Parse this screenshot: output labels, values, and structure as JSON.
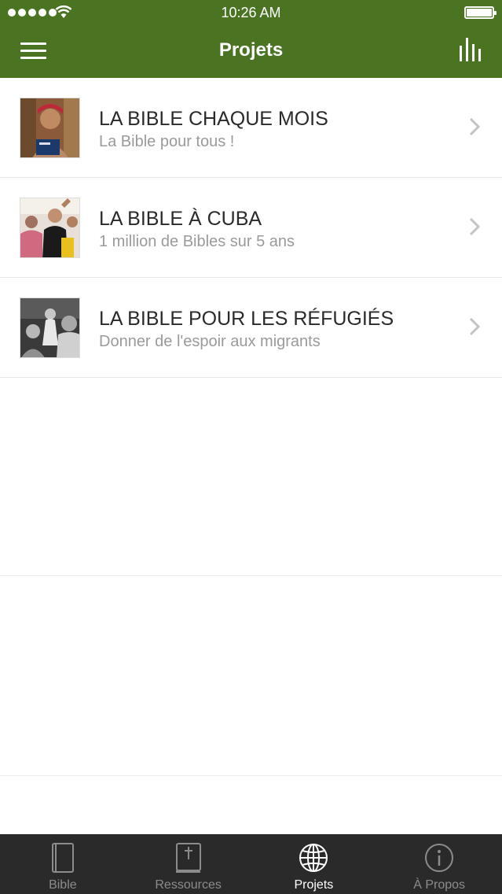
{
  "status_bar": {
    "time": "10:26 AM"
  },
  "header": {
    "title": "Projets"
  },
  "projects": [
    {
      "title": "LA BIBLE CHAQUE MOIS",
      "subtitle": "La Bible pour tous !"
    },
    {
      "title": "LA BIBLE À CUBA",
      "subtitle": "1 million de Bibles sur 5 ans"
    },
    {
      "title": "LA BIBLE POUR LES RÉFUGIÉS",
      "subtitle": "Donner de l'espoir aux migrants"
    }
  ],
  "tabs": [
    {
      "label": "Bible",
      "icon": "book-icon",
      "active": false
    },
    {
      "label": "Ressources",
      "icon": "bible-cross-icon",
      "active": false
    },
    {
      "label": "Projets",
      "icon": "globe-icon",
      "active": true
    },
    {
      "label": "À Propos",
      "icon": "info-icon",
      "active": false
    }
  ],
  "colors": {
    "header": "#4a7422",
    "tabbar": "#2a2a2a",
    "title_text": "#2a2a2a",
    "subtitle_text": "#9a9a9a"
  }
}
